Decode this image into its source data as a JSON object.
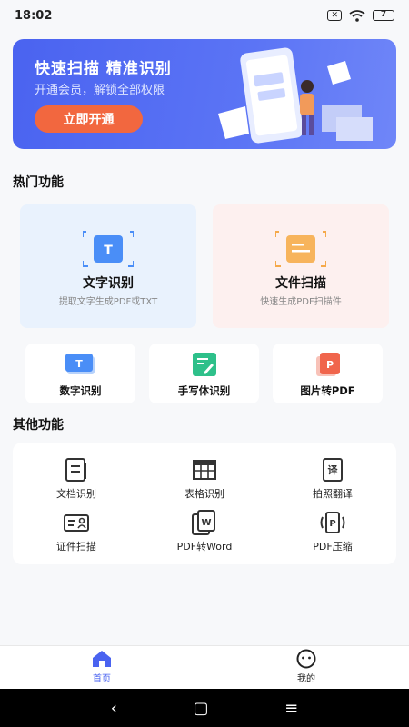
{
  "status_bar": {
    "time": "18:02",
    "battery": "7"
  },
  "banner": {
    "title": "快速扫描  精准识别",
    "subtitle": "开通会员，解锁全部权限",
    "button": "立即开通"
  },
  "hot_section": {
    "title": "热门功能",
    "big_cards": [
      {
        "title": "文字识别",
        "desc": "提取文字生成PDF或TXT",
        "icon": "text-scan-icon",
        "bg": "#e9f2fd",
        "accent": "#4a8ef7"
      },
      {
        "title": "文件扫描",
        "desc": "快速生成PDF扫描件",
        "icon": "file-scan-icon",
        "bg": "#fdf0ef",
        "accent": "#f5a94a"
      }
    ],
    "small_cards": [
      {
        "label": "数字识别",
        "icon": "number-icon"
      },
      {
        "label": "手写体识别",
        "icon": "handwriting-icon"
      },
      {
        "label": "图片转PDF",
        "icon": "image-to-pdf-icon"
      }
    ]
  },
  "other_section": {
    "title": "其他功能",
    "items": [
      {
        "label": "文档识别",
        "icon": "document-icon"
      },
      {
        "label": "表格识别",
        "icon": "table-icon"
      },
      {
        "label": "拍照翻译",
        "icon": "translate-icon"
      },
      {
        "label": "证件扫描",
        "icon": "id-card-icon"
      },
      {
        "label": "PDF转Word",
        "icon": "pdf-to-word-icon"
      },
      {
        "label": "PDF压缩",
        "icon": "pdf-compress-icon"
      }
    ]
  },
  "bottom_nav": [
    {
      "label": "首页",
      "icon": "home-icon",
      "active": true
    },
    {
      "label": "我的",
      "icon": "profile-icon",
      "active": false
    }
  ],
  "colors": {
    "accent": "#4a63f0",
    "button": "#f2673f"
  }
}
